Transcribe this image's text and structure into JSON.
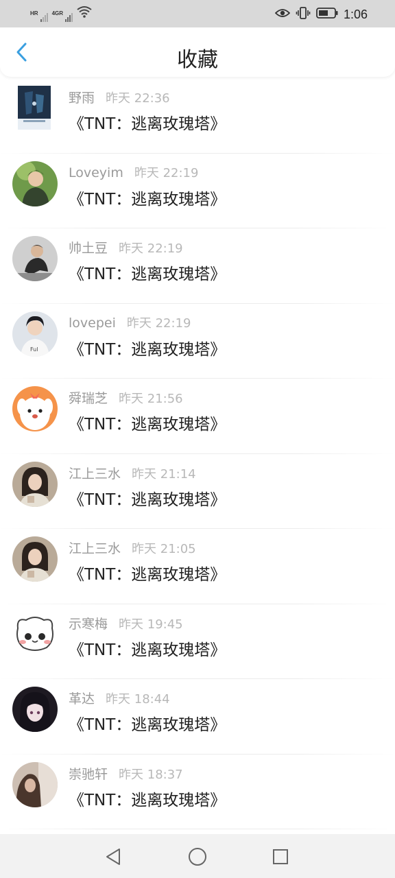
{
  "status_bar": {
    "sim1_label": "HR",
    "sim2_label": "4GR",
    "time": "1:06",
    "icons": [
      "wifi-icon",
      "eye-icon",
      "vibrate-icon",
      "battery-icon"
    ]
  },
  "header": {
    "title": "收藏",
    "back_icon": "chevron-left-icon"
  },
  "items": [
    {
      "user": "野雨",
      "time": "昨天 22:36",
      "title": "《TNT：逃离玫瑰塔》"
    },
    {
      "user": "Loveyim",
      "time": "昨天 22:19",
      "title": "《TNT：逃离玫瑰塔》"
    },
    {
      "user": "帅土豆",
      "time": "昨天 22:19",
      "title": "《TNT：逃离玫瑰塔》"
    },
    {
      "user": "lovepei",
      "time": "昨天 22:19",
      "title": "《TNT：逃离玫瑰塔》"
    },
    {
      "user": "舜瑞芝",
      "time": "昨天 21:56",
      "title": "《TNT：逃离玫瑰塔》"
    },
    {
      "user": "江上三水",
      "time": "昨天 21:14",
      "title": "《TNT：逃离玫瑰塔》"
    },
    {
      "user": "江上三水",
      "time": "昨天 21:05",
      "title": "《TNT：逃离玫瑰塔》"
    },
    {
      "user": "示寒梅",
      "time": "昨天 19:45",
      "title": "《TNT：逃离玫瑰塔》"
    },
    {
      "user": "革达",
      "time": "昨天 18:44",
      "title": "《TNT：逃离玫瑰塔》"
    },
    {
      "user": "崇驰轩",
      "time": "昨天 18:37",
      "title": "《TNT：逃离玫瑰塔》"
    }
  ],
  "bottom_nav": [
    "back-triangle-icon",
    "home-circle-icon",
    "recents-square-icon"
  ],
  "colors": {
    "accent": "#3a9fe0",
    "status_bar_bg": "#d9d9d9",
    "name_gray": "#9a9a9a",
    "time_gray": "#b8b8b8"
  }
}
